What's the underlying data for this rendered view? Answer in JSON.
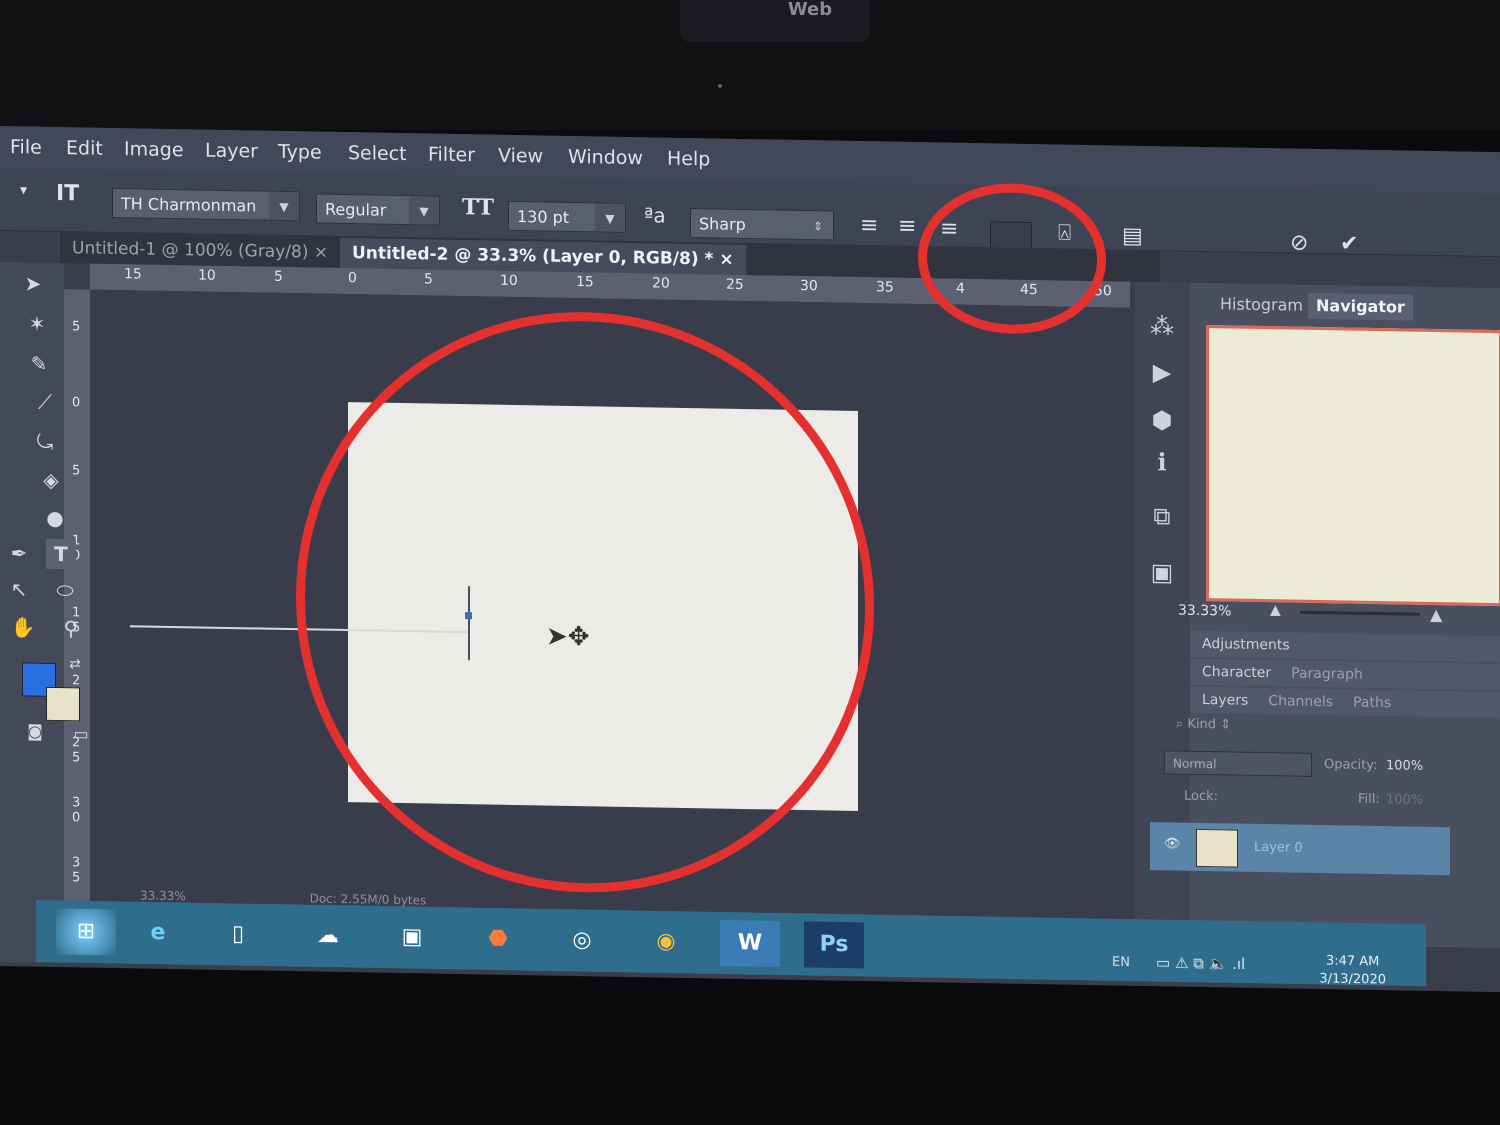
{
  "webcam_label": "Web",
  "menu": [
    "File",
    "Edit",
    "Image",
    "Layer",
    "Type",
    "Select",
    "Filter",
    "View",
    "Window",
    "Help"
  ],
  "options": {
    "font_family": "TH Charmonman",
    "font_style": "Regular",
    "font_size": "130 pt",
    "antialias": "Sharp"
  },
  "tabs": {
    "tab1": "Untitled-1 @ 100% (Gray/8)",
    "tab2": "Untitled-2 @ 33.3% (Layer 0, RGB/8) *"
  },
  "ruler_h": [
    "15",
    "10",
    "5",
    "0",
    "5",
    "10",
    "15",
    "20",
    "25",
    "30",
    "35",
    "4",
    "45",
    "50"
  ],
  "ruler_v": [
    "5",
    "0",
    "5",
    "1 0",
    "1 5",
    "2 0",
    "2 5",
    "3 0",
    "3 5"
  ],
  "status": {
    "zoom": "33.33%",
    "doc": "Doc: 2.55M/0 bytes"
  },
  "panel": {
    "histogram": "Histogram",
    "navigator": "Navigator",
    "zoom": "33.33%",
    "adjustments": "Adjustments",
    "character": "Character",
    "paragraph": "Paragraph",
    "layers": "Layers",
    "channels": "Channels",
    "paths": "Paths",
    "kind": "Kind",
    "blend": "Normal",
    "opacity_label": "Opacity:",
    "opacity": "100%",
    "lock_label": "Lock:",
    "fill_label": "Fill:",
    "fill": "100%",
    "layer_name": "Layer 0"
  },
  "taskbar": {
    "lang": "EN",
    "time": "3:47 AM",
    "date": "3/13/2020",
    "apps": [
      "e",
      "",
      "",
      "",
      "",
      "",
      "",
      "W",
      "Ps"
    ]
  },
  "colors": {
    "annotation": "#e4312f",
    "foreground": "#2a6fe0",
    "background": "#e6e3c8"
  }
}
